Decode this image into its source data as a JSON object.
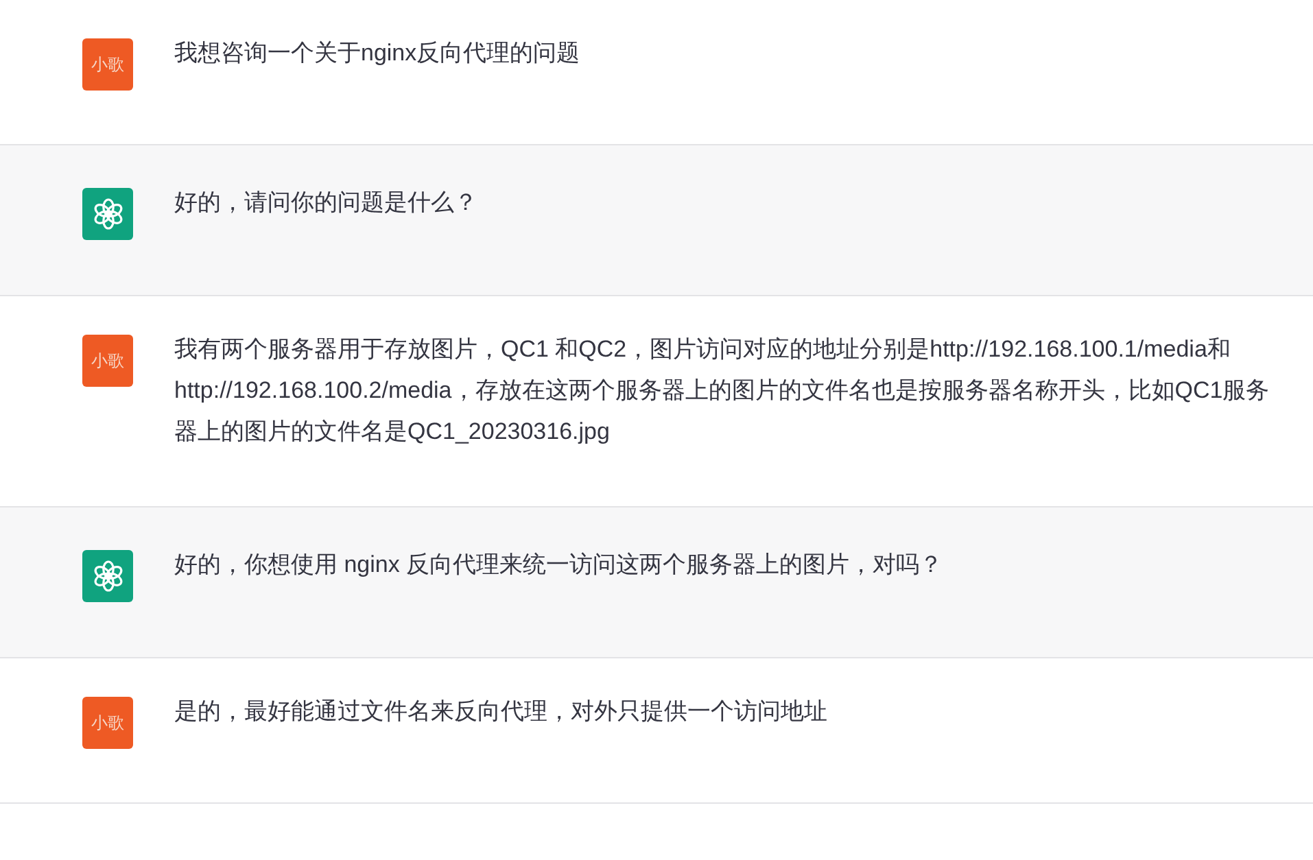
{
  "messages": [
    {
      "kind": "user",
      "avatar": "小歌",
      "text": "我想咨询一个关于nginx反向代理的问题"
    },
    {
      "kind": "assistant",
      "text": "好的，请问你的问题是什么？"
    },
    {
      "kind": "user",
      "avatar": "小歌",
      "text": "我有两个服务器用于存放图片，QC1 和QC2，图片访问对应的地址分别是http://192.168.100.1/media和http://192.168.100.2/media，存放在这两个服务器上的图片的文件名也是按服务器名称开头，比如QC1服务器上的图片的文件名是QC1_20230316.jpg"
    },
    {
      "kind": "assistant",
      "text": "好的，你想使用 nginx 反向代理来统一访问这两个服务器上的图片，对吗？"
    },
    {
      "kind": "user",
      "avatar": "小歌",
      "text": "是的，最好能通过文件名来反向代理，对外只提供一个访问地址"
    }
  ]
}
